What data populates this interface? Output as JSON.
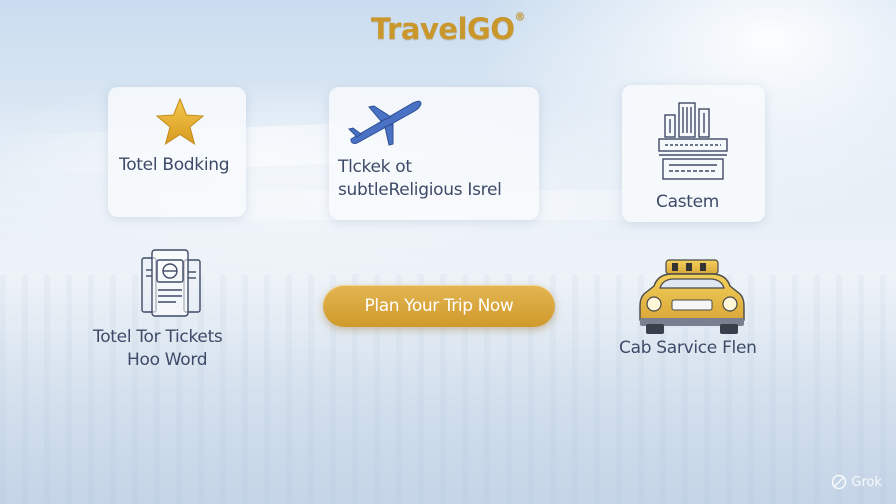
{
  "app": {
    "brand_name": "TravelGO",
    "brand_mark": "®",
    "accent_color": "#c9972b"
  },
  "services": {
    "hotel": {
      "label": "Totel Bodking",
      "icon": "star-icon"
    },
    "tickets": {
      "label_line1": "Tlckek ot",
      "label_line2": "subtleReligious Isrel",
      "icon": "airplane-icon"
    },
    "custom": {
      "label": "Castem",
      "icon": "building-icon"
    },
    "tour_tickets": {
      "label_line1": "Totel Tor Tickets",
      "label_line2": "Hoo Word",
      "icon": "ticket-booklet-icon"
    },
    "cab": {
      "label": "Cab Sarvice Flen",
      "icon": "taxi-icon"
    }
  },
  "cta": {
    "label": "Plan Your Trip Now"
  },
  "watermark": {
    "label": "Grok"
  }
}
